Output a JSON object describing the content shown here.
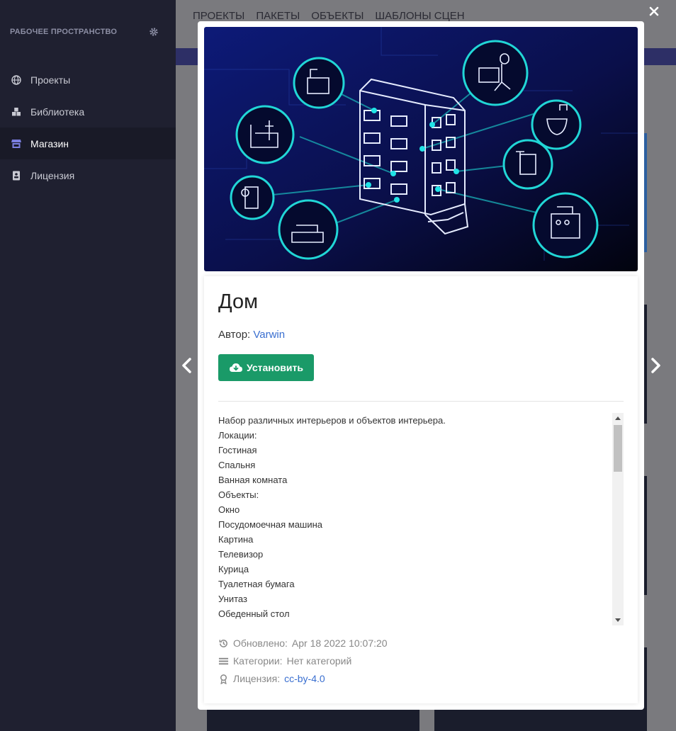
{
  "sidebar": {
    "workspace_title": "РАБОЧЕЕ ПРОСТРАНСТВО",
    "items": [
      {
        "label": "Проекты",
        "icon": "globe-icon"
      },
      {
        "label": "Библиотека",
        "icon": "cubes-icon"
      },
      {
        "label": "Магазин",
        "icon": "store-icon"
      },
      {
        "label": "Лицензия",
        "icon": "id-card-icon"
      }
    ],
    "active_item": "Магазин"
  },
  "topnav": {
    "items": [
      "ПРОЕКТЫ",
      "ПАКЕТЫ",
      "ОБЪЕКТЫ",
      "ШАБЛОНЫ СЦЕН"
    ]
  },
  "modal": {
    "title": "Дом",
    "author_label": "Автор:",
    "author_name": "Varwin",
    "install_label": "Установить",
    "description_lines": [
      "Набор различных интерьеров и объектов интерьера.",
      "Локации:",
      "Гостиная",
      "Спальня",
      "Ванная комната",
      "Объекты:",
      "Окно",
      "Посудомоечная машина",
      "Картина",
      "Телевизор",
      "Курица",
      "Туалетная бумага",
      "Унитаз",
      "Обеденный стол"
    ],
    "updated_label": "Обновлено:",
    "updated_value": "Apr 18 2022 10:07:20",
    "categories_label": "Категории:",
    "categories_value": "Нет категорий",
    "license_label": "Лицензия:",
    "license_value": "cc-by-4.0"
  },
  "colors": {
    "sidebar_bg": "#1f2030",
    "install_button": "#1a9a68",
    "link": "#3a6fd0",
    "hero_bg": "#0a1250",
    "hero_accent": "#21d6d6"
  }
}
